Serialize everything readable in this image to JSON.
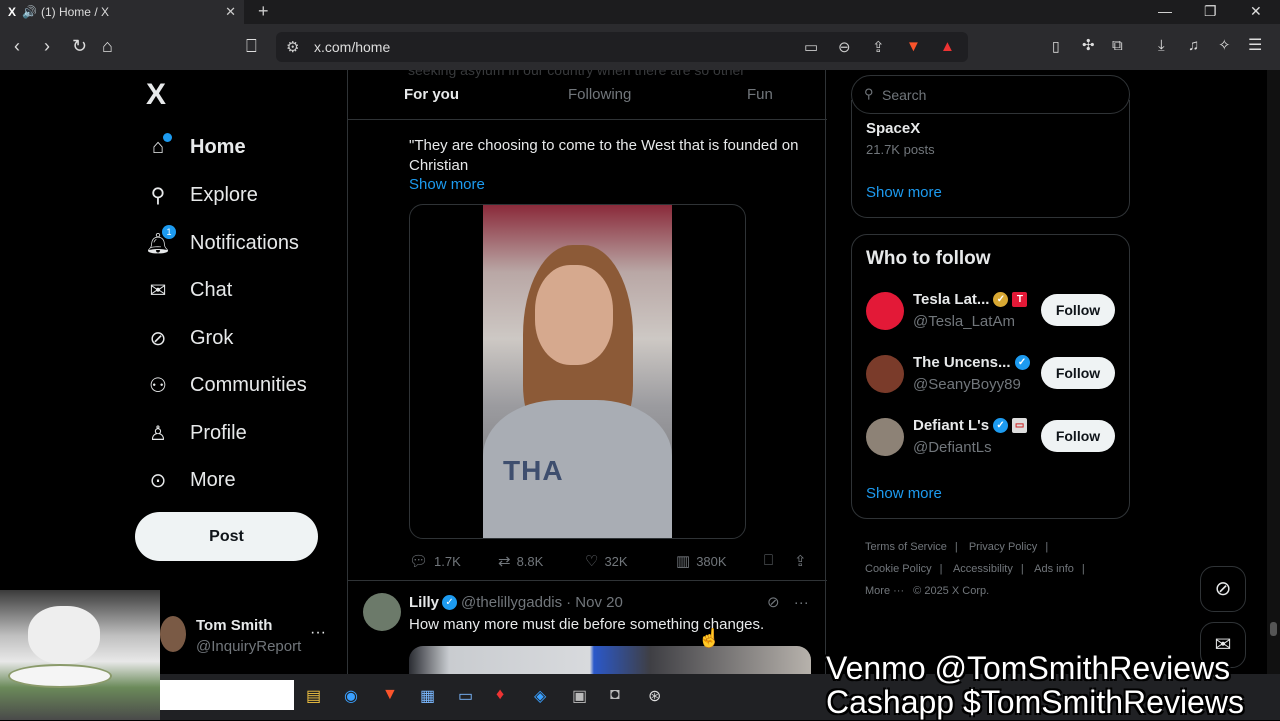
{
  "browser": {
    "tab_title": "(1) Home / X",
    "tab_logo": "X",
    "url": "x.com/home"
  },
  "sidebar": {
    "logo": "X",
    "items": [
      {
        "label": "Home",
        "icon": "home-icon"
      },
      {
        "label": "Explore",
        "icon": "search-icon"
      },
      {
        "label": "Notifications",
        "icon": "bell-icon",
        "badge": "1"
      },
      {
        "label": "Chat",
        "icon": "mail-icon"
      },
      {
        "label": "Grok",
        "icon": "grok-icon"
      },
      {
        "label": "Communities",
        "icon": "communities-icon"
      },
      {
        "label": "Profile",
        "icon": "person-icon"
      },
      {
        "label": "More",
        "icon": "more-circle-icon"
      }
    ],
    "post_label": "Post",
    "account": {
      "name": "Tom Smith",
      "handle": "@InquiryReport"
    }
  },
  "feed": {
    "tabs": [
      "For you",
      "Following",
      "Fun"
    ],
    "ghost_text": "seeking asylum in our country when there are so other",
    "tweet1": {
      "text": "\"They are choosing to come to the West that is founded on Christian",
      "show_more": "Show more",
      "video_shirt_text": "THA",
      "actions": {
        "replies": "1.7K",
        "reposts": "8.8K",
        "likes": "32K",
        "views": "380K"
      }
    },
    "tweet2": {
      "name": "Lilly",
      "handle": "@thelillygaddis",
      "date": "· Nov 20",
      "text": "How many more must die before something changes."
    }
  },
  "right": {
    "search_placeholder": "Search",
    "trend": {
      "name": "SpaceX",
      "count": "21.7K posts",
      "show_more": "Show more"
    },
    "who_to_follow": {
      "title": "Who to follow",
      "accounts": [
        {
          "name": "Tesla Lat...",
          "handle": "@Tesla_LatAm",
          "button": "Follow"
        },
        {
          "name": "The Uncens...",
          "handle": "@SeanyBoyy89",
          "button": "Follow"
        },
        {
          "name": "Defiant L's",
          "handle": "@DefiantLs",
          "button": "Follow"
        }
      ],
      "show_more": "Show more"
    },
    "footer": {
      "links": [
        "Terms of Service",
        "Privacy Policy",
        "Cookie Policy",
        "Accessibility",
        "Ads info",
        "More ···"
      ],
      "copyright": "© 2025 X Corp."
    }
  },
  "overlay": {
    "line1": "Venmo @TomSmithReviews",
    "line2": "Cashapp $TomSmithReviews"
  },
  "colors": {
    "accent": "#1d9bf0",
    "background": "#000000",
    "text": "#e7e9ea",
    "muted": "#71767b"
  }
}
